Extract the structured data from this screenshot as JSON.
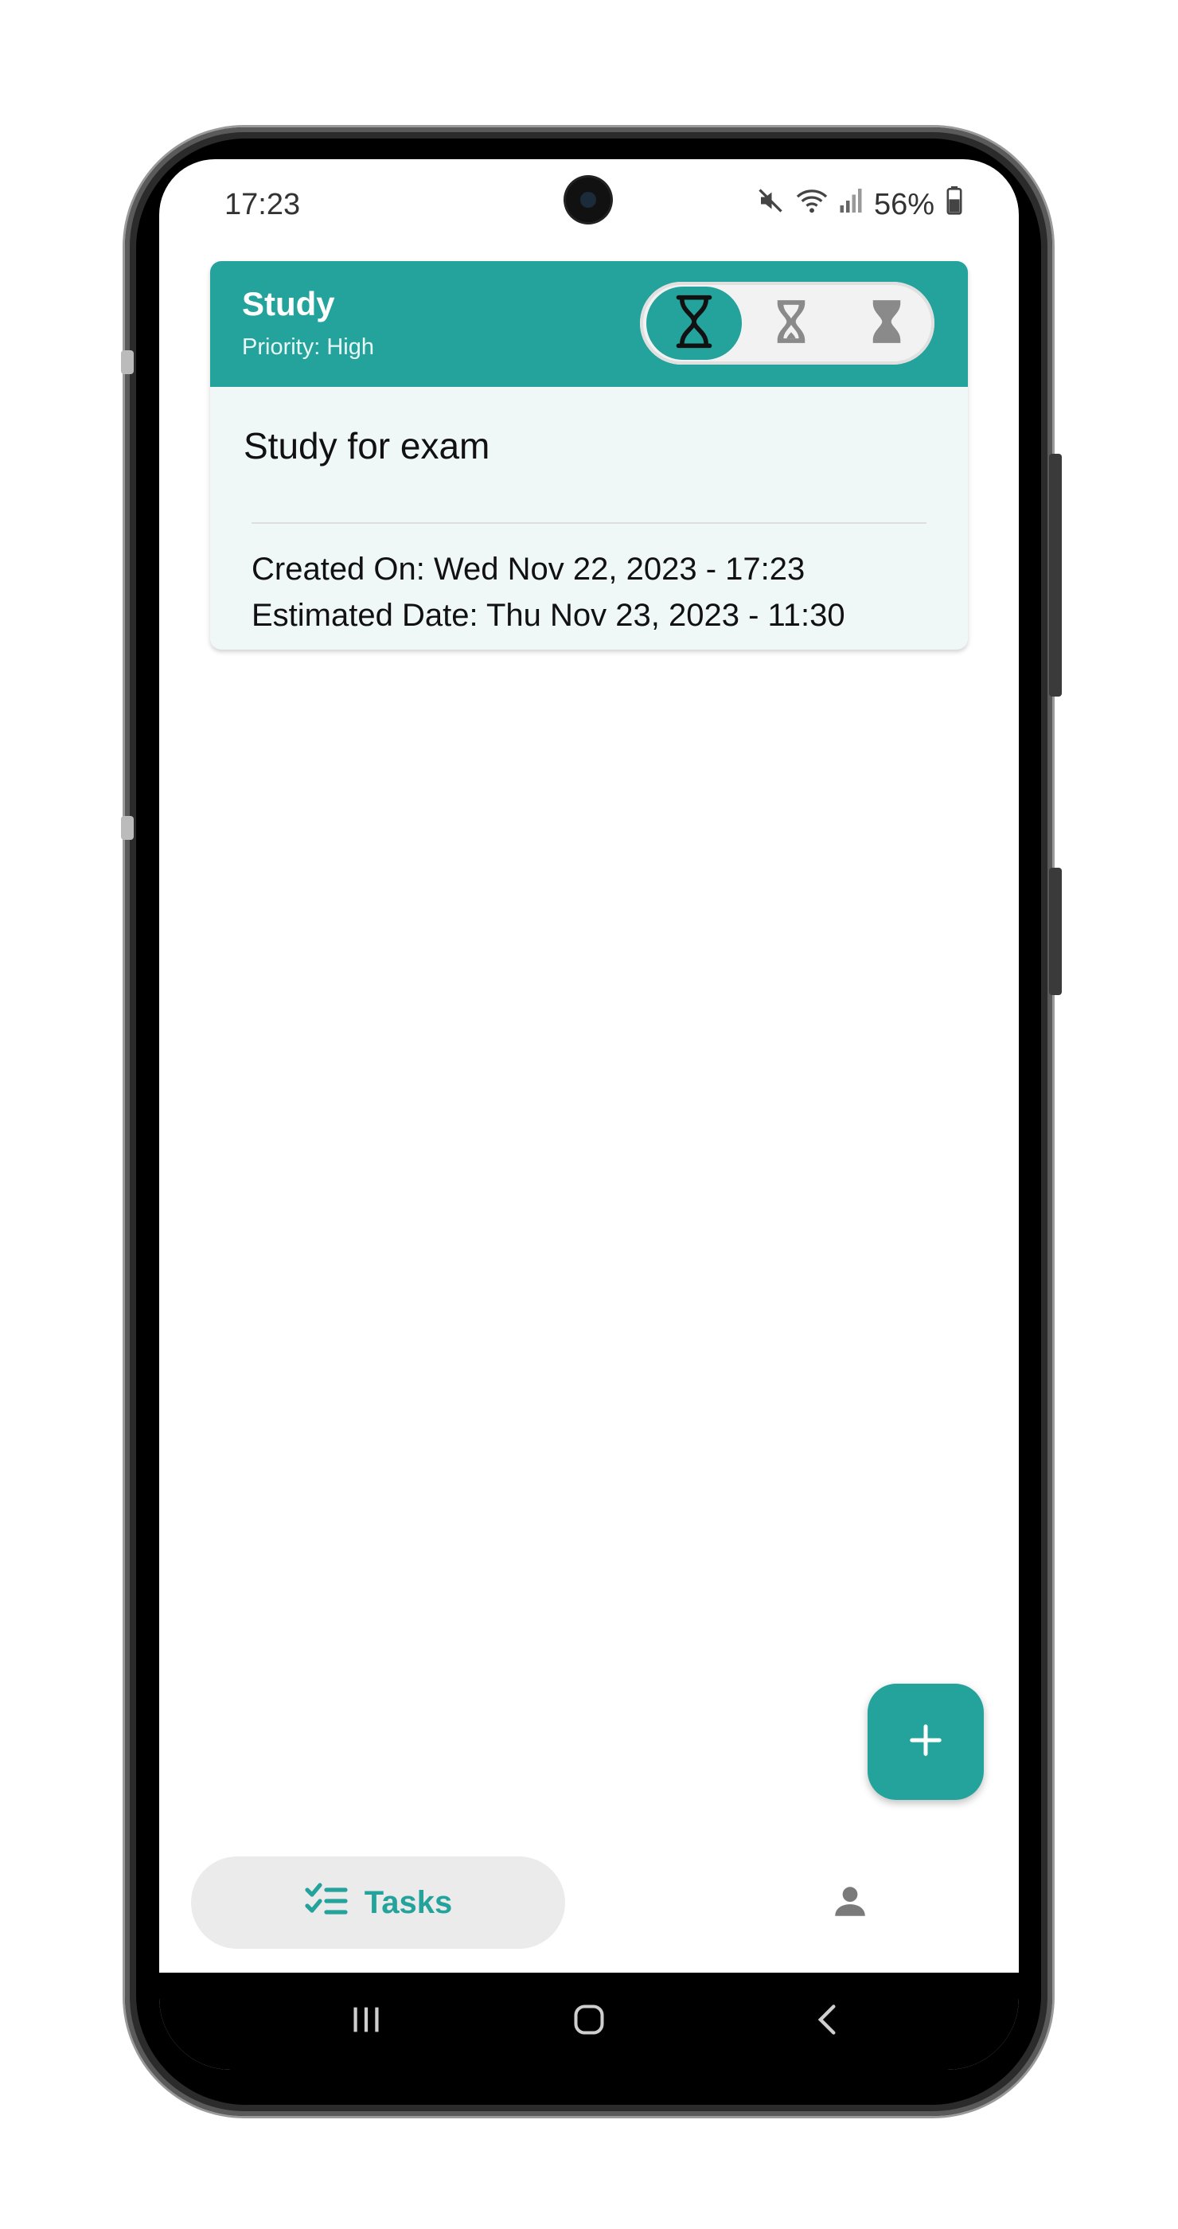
{
  "status_bar": {
    "time": "17:23",
    "battery": "56%"
  },
  "task_card": {
    "title": "Study",
    "priority": "Priority: High",
    "description": "Study for exam",
    "created_on": "Created On: Wed Nov 22, 2023 - 17:23",
    "estimated_date": "Estimated Date: Thu Nov 23, 2023 - 11:30",
    "status_toggle": {
      "options": [
        "hourglass-empty-icon",
        "hourglass-top-icon",
        "hourglass-full-icon"
      ],
      "selected_index": 0
    }
  },
  "fab": {
    "icon": "plus-icon"
  },
  "bottom_nav": {
    "tasks_label": "Tasks",
    "tasks_icon": "checklist-icon",
    "profile_icon": "person-icon"
  },
  "system_nav": {
    "buttons": [
      "recents-icon",
      "home-icon",
      "back-icon"
    ]
  },
  "colors": {
    "accent": "#23a39b",
    "card_background": "#f0f8f7",
    "nav_pill": "#ebebeb"
  }
}
